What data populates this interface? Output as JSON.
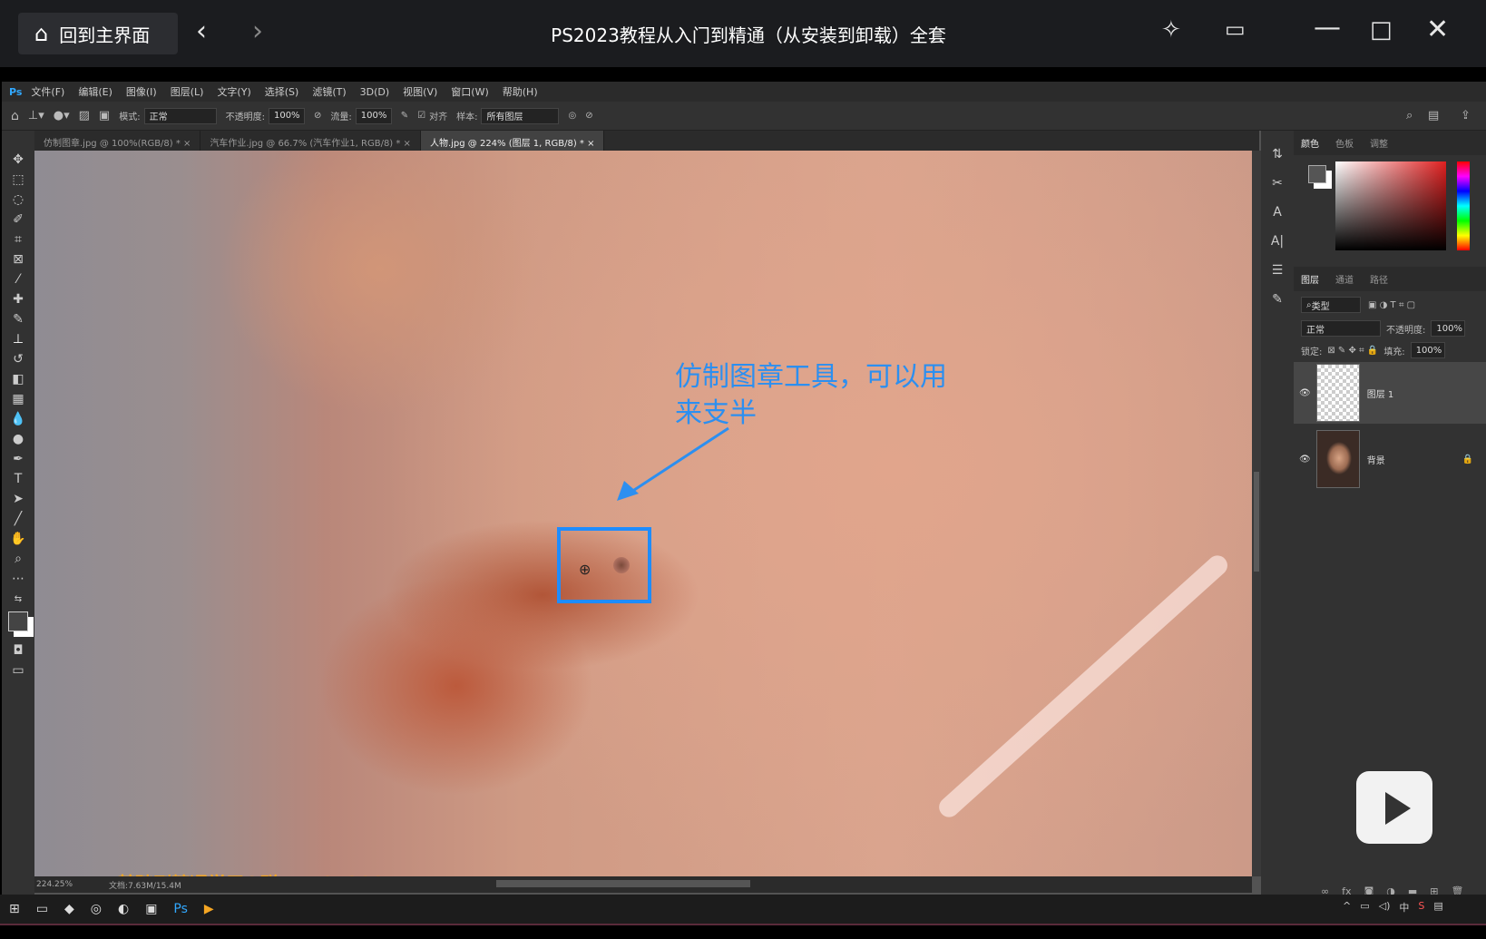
{
  "player": {
    "home_label": "回到主界面",
    "title": "PS2023教程从入门到精通（从安装到卸载）全套"
  },
  "ps": {
    "menu": [
      "文件(F)",
      "编辑(E)",
      "图像(I)",
      "图层(L)",
      "文字(Y)",
      "选择(S)",
      "滤镜(T)",
      "3D(D)",
      "视图(V)",
      "窗口(W)",
      "帮助(H)"
    ],
    "options": {
      "mode_label": "模式:",
      "mode_value": "正常",
      "opacity_label": "不透明度:",
      "opacity_value": "100%",
      "flow_label": "流量:",
      "flow_value": "100%",
      "align_label": "对齐",
      "sample_label": "样本:",
      "sample_value": "所有图层"
    },
    "tabs": [
      "仿制图章.jpg @ 100%(RGB/8) * ×",
      "汽车作业.jpg @ 66.7% (汽车作业1, RGB/8) * ×",
      "人物.jpg @ 224% (图层 1, RGB/8) * ×"
    ],
    "annotation": "仿制图章工具，可以用来支半",
    "watermark": "Ps基础到精通学习Q群：4401308",
    "status": {
      "zoom": "224.25%",
      "doc": "文档:7.63M/15.4M"
    },
    "panels": {
      "color_tabs": [
        "颜色",
        "色板",
        "调整"
      ],
      "layer_tabs": [
        "图层",
        "通道",
        "路径"
      ],
      "kind_label": "类型",
      "blend_mode": "正常",
      "opacity_label": "不透明度:",
      "opacity_value": "100%",
      "lock_label": "锁定:",
      "fill_label": "填充:",
      "fill_value": "100%",
      "layers": [
        {
          "name": "图层 1"
        },
        {
          "name": "背景"
        }
      ]
    }
  }
}
